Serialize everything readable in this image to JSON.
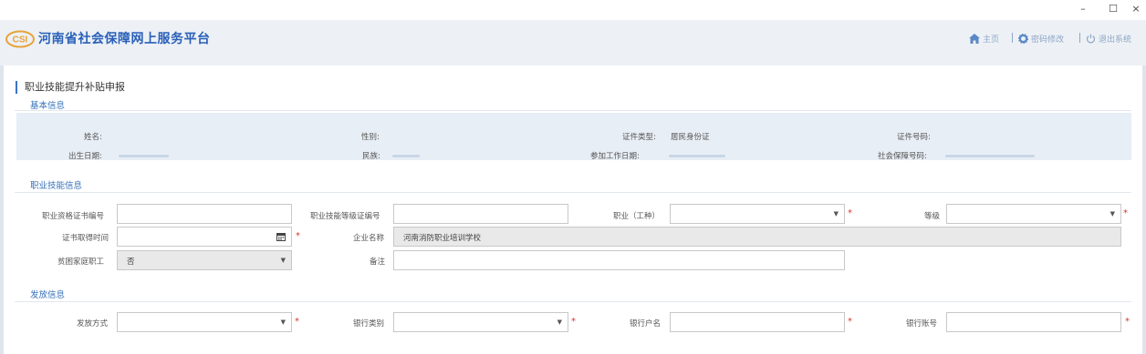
{
  "window": {
    "minimize": "–",
    "maximize": "☐",
    "close": "×"
  },
  "header": {
    "logo_text": "CSI",
    "brand": "河南省社会保障网上服务平台",
    "nav": {
      "home": "主页",
      "password": "密码修改",
      "logout": "退出系统"
    }
  },
  "page": {
    "title": "职业技能提升补贴申报"
  },
  "basic": {
    "section_title": "基本信息",
    "name_label": "姓名:",
    "gender_label": "性别:",
    "id_type_label": "证件类型:",
    "id_type_value": "居民身份证",
    "id_number_label": "证件号码:",
    "birth_label": "出生日期:",
    "ethnicity_label": "民族:",
    "work_date_label": "参加工作日期:",
    "ssn_label": "社会保障号码:"
  },
  "skill": {
    "section_title": "职业技能信息",
    "cert_no_label": "职业资格证书编号",
    "cert_no_value": "",
    "level_cert_label": "职业技能等级证编号",
    "level_cert_value": "",
    "occupation_label": "职业（工种）",
    "occupation_value": "",
    "grade_label": "等级",
    "grade_value": "",
    "obtain_date_label": "证书取得时间",
    "obtain_date_value": "",
    "company_label": "企业名称",
    "company_value": "河南消防职业培训学校",
    "poor_family_label": "贫困家庭职工",
    "poor_family_value": "否",
    "remark_label": "备注",
    "remark_value": ""
  },
  "payment": {
    "section_title": "发放信息",
    "method_label": "发放方式",
    "method_value": "",
    "bank_type_label": "银行类别",
    "bank_type_value": "",
    "account_name_label": "银行户名",
    "account_name_value": "",
    "account_no_label": "银行账号",
    "account_no_value": ""
  },
  "required_mark": "*",
  "colors": {
    "accent": "#3670b8",
    "brand": "#2a60b8",
    "header_bg": "#edf1f6",
    "info_bg": "#e8eef5",
    "required": "#d9342b"
  }
}
